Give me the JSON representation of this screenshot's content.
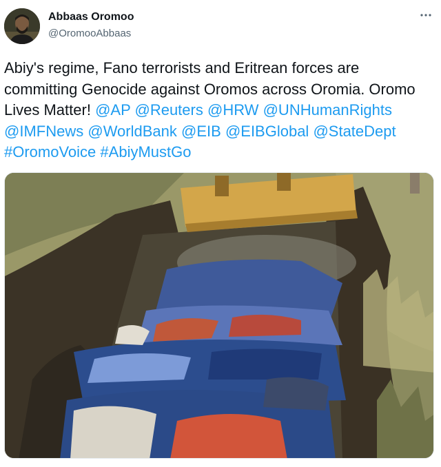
{
  "author": {
    "display_name": "Abbaas Oromoo",
    "handle": "@OromooAbbaas",
    "avatar_icon": "person-avatar-icon"
  },
  "more_icon": "more-dots-icon",
  "tweet": {
    "text_plain": "Abiy's regime, Fano terrorists and Eritrean forces are committing Genocide against Oromos across Oromia. Oromo Lives Matter!",
    "mentions": [
      "@AP",
      "@Reuters",
      "@HRW",
      "@UNHumanRights",
      "@IMFNews",
      "@WorldBank",
      "@EIB",
      "@EIBGlobal",
      "@StateDept"
    ],
    "hashtags": [
      "#OromoVoice",
      "#AbiyMustGo"
    ]
  },
  "colors": {
    "link": "#1d9bf0",
    "text": "#0f1419",
    "secondary": "#536471"
  }
}
